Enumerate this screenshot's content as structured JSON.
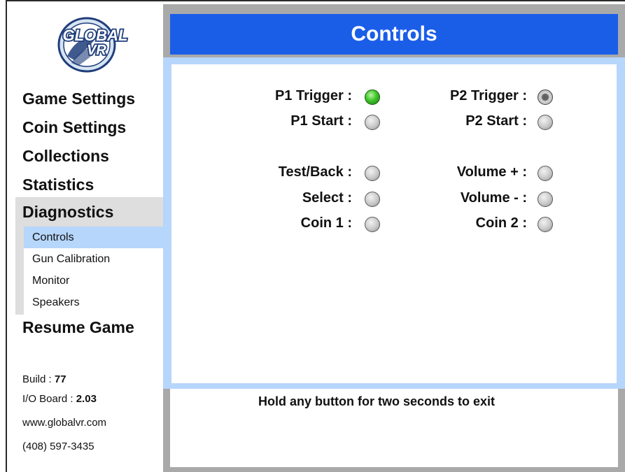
{
  "logo": {
    "text": "GLOBAL VR"
  },
  "sidebar": {
    "items": [
      {
        "label": "Game Settings"
      },
      {
        "label": "Coin Settings"
      },
      {
        "label": "Collections"
      },
      {
        "label": "Statistics"
      }
    ],
    "diagnostics": {
      "label": "Diagnostics",
      "subitems": [
        {
          "label": "Controls",
          "selected": true
        },
        {
          "label": "Gun Calibration"
        },
        {
          "label": "Monitor"
        },
        {
          "label": "Speakers"
        }
      ]
    },
    "resume_label": "Resume Game",
    "info": {
      "build_label": "Build :",
      "build_value": "77",
      "io_label": "I/O Board :",
      "io_value": "2.03",
      "website": "www.globalvr.com",
      "phone": "(408) 597-3435"
    }
  },
  "header": {
    "title": "Controls"
  },
  "controls": {
    "left": [
      {
        "label": "P1 Trigger :",
        "state": "on"
      },
      {
        "label": "P1 Start :",
        "state": "off"
      },
      {
        "label": "Test/Back :",
        "state": "off"
      },
      {
        "label": "Select :",
        "state": "off"
      },
      {
        "label": "Coin 1 :",
        "state": "off"
      }
    ],
    "right": [
      {
        "label": "P2 Trigger :",
        "state": "pressed"
      },
      {
        "label": "P2 Start :",
        "state": "off"
      },
      {
        "label": "Volume + :",
        "state": "off"
      },
      {
        "label": "Volume - :",
        "state": "off"
      },
      {
        "label": "Coin 2 :",
        "state": "off"
      }
    ]
  },
  "footer": {
    "text": "Hold any button for two seconds to exit"
  },
  "colors": {
    "header_bg": "#1a5ee8",
    "selected_bg": "#b6d6fb",
    "led_on": "#3fc42a"
  }
}
